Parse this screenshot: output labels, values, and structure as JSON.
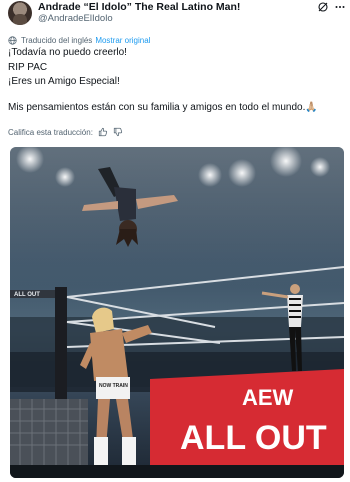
{
  "author": {
    "display_name": "Andrade “El Idolo” The Real Latino Man!",
    "handle": "@AndradeElIdolo"
  },
  "translation": {
    "label": "Traducido del inglés",
    "show_original": "Mostrar original"
  },
  "tweet": {
    "lines": [
      "¡Todavía no puedo creerlo!",
      "RIP PAC",
      "¡Eres un Amigo Especial!",
      "Mis pensamientos están con su familia y amigos en todo el mundo.🙏🏼"
    ]
  },
  "rate_translation": "Califica esta traducción:",
  "media": {
    "banner_brand": "AEW",
    "banner_event": "ALL OUT",
    "small_banner": "ALL OUT",
    "trunks_text": "NOW TRAIN"
  },
  "icons": {
    "grok": "grok-icon",
    "more": "more-icon",
    "globe": "globe-icon",
    "thumbs_up": "thumbs-up-icon",
    "thumbs_down": "thumbs-down-icon"
  },
  "colors": {
    "link": "#1d9bf0",
    "muted": "#536471",
    "banner_red": "#d62b33"
  }
}
